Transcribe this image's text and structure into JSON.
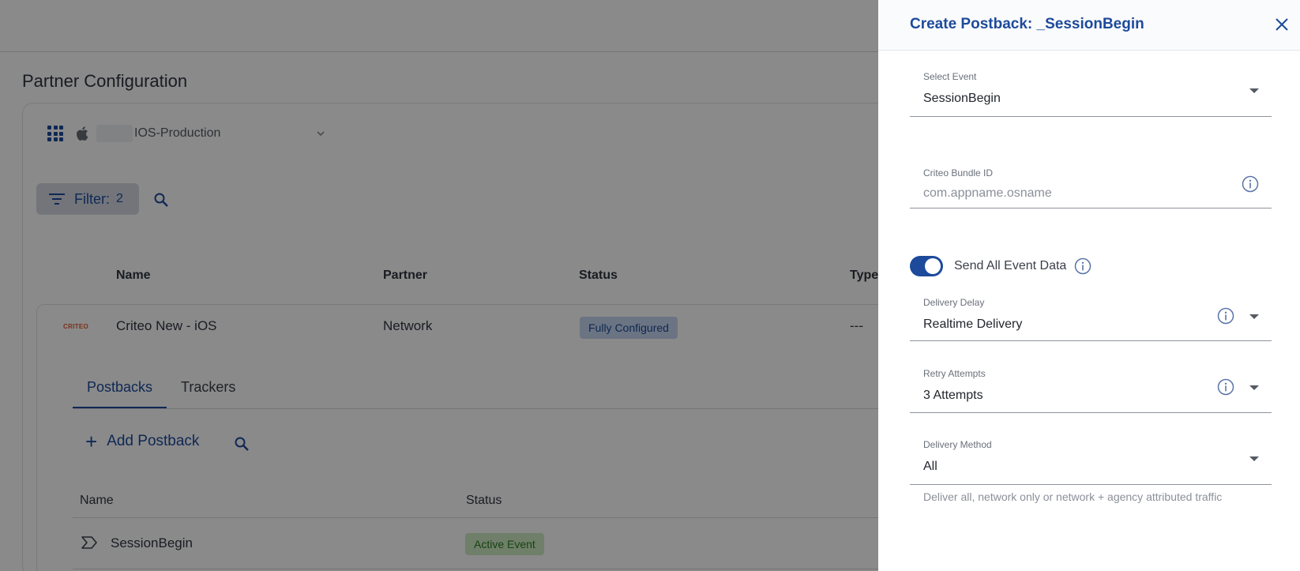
{
  "page": {
    "title": "Partner Configuration",
    "app_name": "IOS-Production",
    "filter_label": "Filter:",
    "filter_count": "2",
    "table_headers": [
      "Name",
      "Partner",
      "Status",
      "Type"
    ],
    "partner_row": {
      "logo_text": "CRITEO",
      "name": "Criteo New - iOS",
      "partner": "Network",
      "status": "Fully Configured",
      "type": "---"
    },
    "tabs": [
      "Postbacks",
      "Trackers"
    ],
    "add_postback_label": "Add Postback",
    "sub_headers": [
      "Name",
      "Status"
    ],
    "event_row": {
      "name": "SessionBegin",
      "status": "Active Event"
    }
  },
  "panel": {
    "title": "Create Postback: _SessionBegin",
    "select_event": {
      "label": "Select Event",
      "value": "SessionBegin"
    },
    "bundle_id": {
      "label": "Criteo Bundle ID",
      "placeholder": "com.appname.osname"
    },
    "send_all": {
      "label": "Send All Event Data",
      "enabled": true
    },
    "delivery_delay": {
      "label": "Delivery Delay",
      "value": "Realtime Delivery"
    },
    "retry_attempts": {
      "label": "Retry Attempts",
      "value": "3 Attempts"
    },
    "delivery_method": {
      "label": "Delivery Method",
      "value": "All",
      "helper": "Deliver all, network only or network + agency attributed traffic"
    }
  },
  "colors": {
    "accent": "#1d4a9b",
    "chip_blue": "#c6d7f1",
    "chip_green": "#cdeac3",
    "criteo_orange": "#e5582a"
  }
}
